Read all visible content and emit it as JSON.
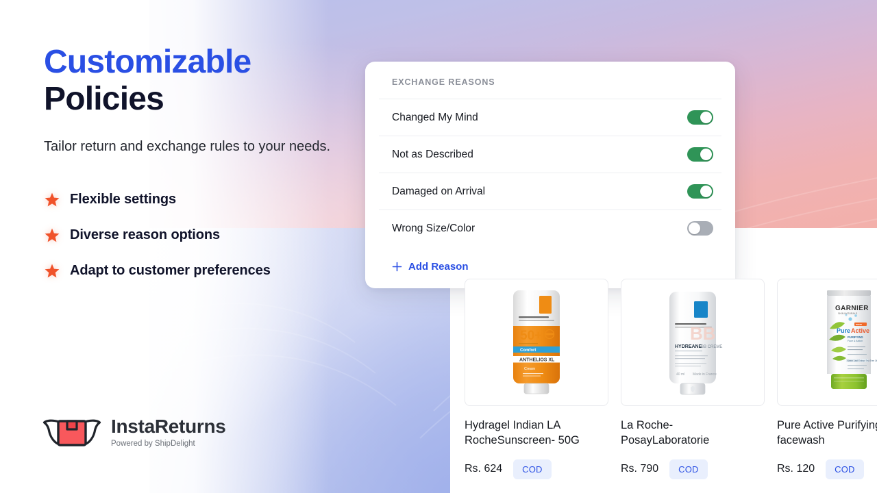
{
  "hero": {
    "title_line1": "Customizable",
    "title_line2": "Policies",
    "subtitle": "Tailor return and exchange rules to your needs.",
    "features": [
      {
        "label": "Flexible settings",
        "icon": "star-icon"
      },
      {
        "label": "Diverse reason options",
        "icon": "star-icon"
      },
      {
        "label": "Adapt to customer preferences",
        "icon": "star-icon"
      }
    ]
  },
  "brand": {
    "name": "InstaReturns",
    "tagline": "Powered by ShipDelight",
    "icon": "winged-box-logo-icon"
  },
  "reasons_card": {
    "header": "EXCHANGE REASONS",
    "rows": [
      {
        "label": "Changed My Mind",
        "enabled": true
      },
      {
        "label": "Not as Described",
        "enabled": true
      },
      {
        "label": "Damaged on Arrival",
        "enabled": true
      },
      {
        "label": "Wrong Size/Color",
        "enabled": false
      }
    ],
    "add_reason_label": "Add Reason",
    "add_reason_icon": "plus-icon"
  },
  "products": [
    {
      "name": "Hydragel Indian LA RocheSunscreen- 50G",
      "price": "Rs. 624",
      "badge": "COD",
      "image": "la-roche-posay-anthelios-sunscreen-tube"
    },
    {
      "name": "La Roche-PosayLaboratorie",
      "price": "Rs. 790",
      "badge": "COD",
      "image": "la-roche-posay-hydreane-bb-cream-tube"
    },
    {
      "name": "Pure Active Purifying facewash",
      "price": "Rs. 120",
      "badge": "COD",
      "image": "garnier-pure-active-facewash-tube"
    }
  ],
  "colors": {
    "accent_blue": "#2a4fe4",
    "star_orange": "#f0522a",
    "toggle_on_green": "#2f9457",
    "toggle_off_gray": "#a9aeb6",
    "badge_bg": "#e9effd",
    "logo_red": "#f8585c"
  }
}
